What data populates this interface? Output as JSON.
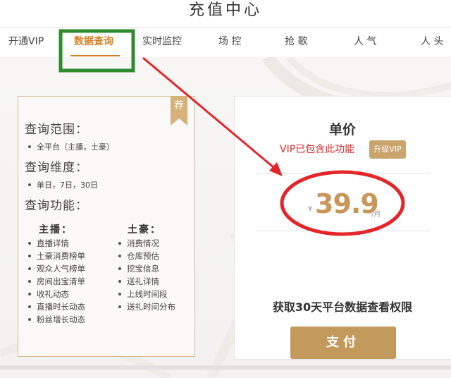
{
  "page": {
    "title": "充值中心"
  },
  "tabs": [
    {
      "label": "开通VIP"
    },
    {
      "label": "数据查询",
      "active": true
    },
    {
      "label": "实时监控"
    },
    {
      "label": "场 控"
    },
    {
      "label": "抢 歌"
    },
    {
      "label": "人 气"
    },
    {
      "label": "人 头"
    }
  ],
  "feature_card": {
    "badge": "荐",
    "scope": {
      "heading": "查询范围：",
      "items": [
        "全平台（主播，土豪）"
      ]
    },
    "dimension": {
      "heading": "查询维度：",
      "items": [
        "单日，7日，30日"
      ]
    },
    "function": {
      "heading": "查询功能：",
      "anchor": {
        "heading": "主播：",
        "items": [
          "直播详情",
          "土豪消费榜单",
          "观众人气榜单",
          "房间出宝清单",
          "收礼动态",
          "直播时长动态",
          "粉丝增长动态"
        ]
      },
      "tycoon": {
        "heading": "土豪：",
        "items": [
          "消费情况",
          "仓库预估",
          "挖宝信息",
          "送礼详情",
          "上线时间段",
          "送礼时间分布"
        ]
      }
    }
  },
  "price_card": {
    "title": "单价",
    "vip_note": "VIP已包含此功能",
    "upgrade_label": "升级VIP",
    "currency": "¥",
    "amount": "39.9",
    "unit": "/月",
    "benefit": "获取30天平台数据查看权限",
    "pay_label": "支付"
  },
  "colors": {
    "accent": "#d4822a",
    "gold": "#c29a5c",
    "price": "#c9965a",
    "vip_red": "#e02b2b",
    "annotation_red": "#e4262b",
    "annotation_green": "#2e8b2e"
  },
  "icons": {
    "badge": "recommend-ribbon"
  }
}
